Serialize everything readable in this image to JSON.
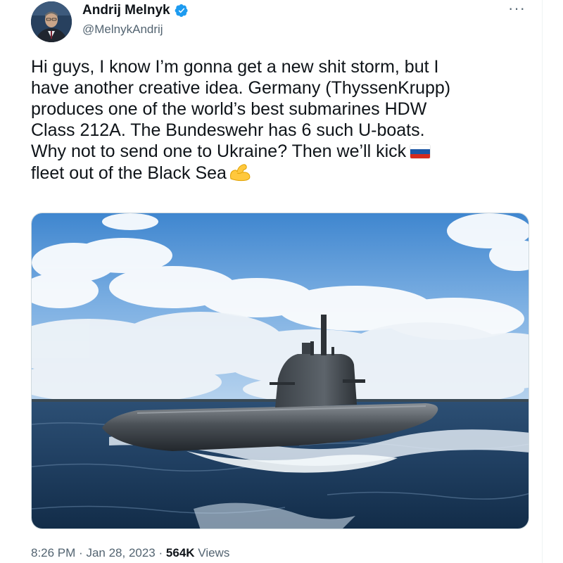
{
  "tweet": {
    "author_name": "Andrij Melnyk",
    "author_handle": "@MelnykAndrij",
    "more_icon_glyph": "···",
    "text_lines": [
      "Hi guys, I know I’m gonna get a new shit storm, but I",
      "have another creative idea. Germany (ThyssenKrupp)",
      "produces one of the world’s best submarines HDW",
      "Class 212A. The Bundeswehr has 6 such U-boats.",
      "Why not to send one to Ukraine? Then we’ll kick",
      "fleet out of the Black Sea"
    ],
    "inline_icons": [
      "russia-flag-icon",
      "flexed-biceps-icon"
    ],
    "time": "8:26 PM",
    "separator": "·",
    "date": "Jan 28, 2023",
    "views_count": "564K",
    "views_label": "Views"
  },
  "colors": {
    "verified": "#1d9bf0",
    "secondary_text": "#536471",
    "primary_text": "#0f1419"
  }
}
